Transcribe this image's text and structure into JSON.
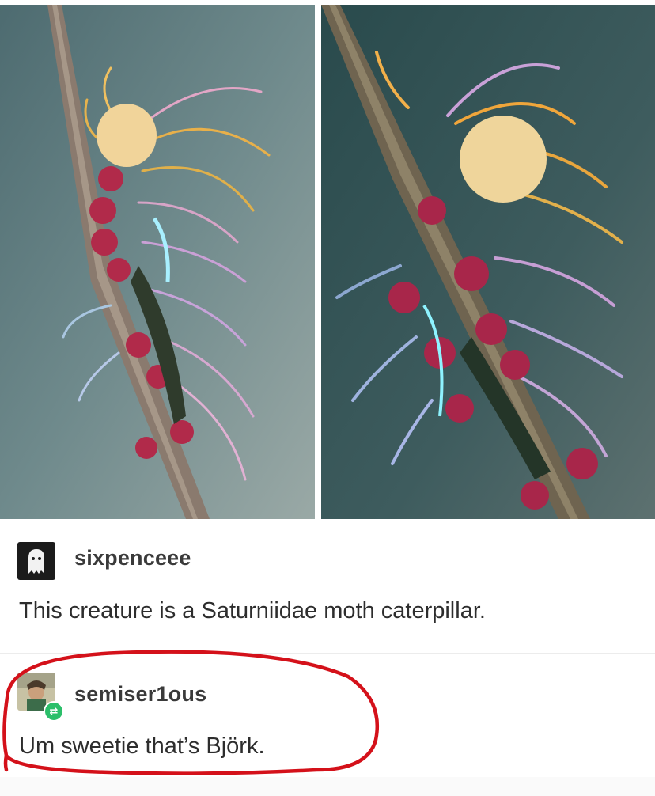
{
  "posts": [
    {
      "username": "sixpenceee",
      "text": "This creature is a Saturniidae moth caterpillar.",
      "avatar_icon": "ghost-icon"
    },
    {
      "username": "semiser1ous",
      "text": "Um sweetie that’s Björk.",
      "avatar_icon": "profile-photo",
      "badge_icon": "reblog-icon"
    }
  ],
  "annotation": {
    "color": "#d4111a",
    "shape": "hand-drawn circle"
  }
}
